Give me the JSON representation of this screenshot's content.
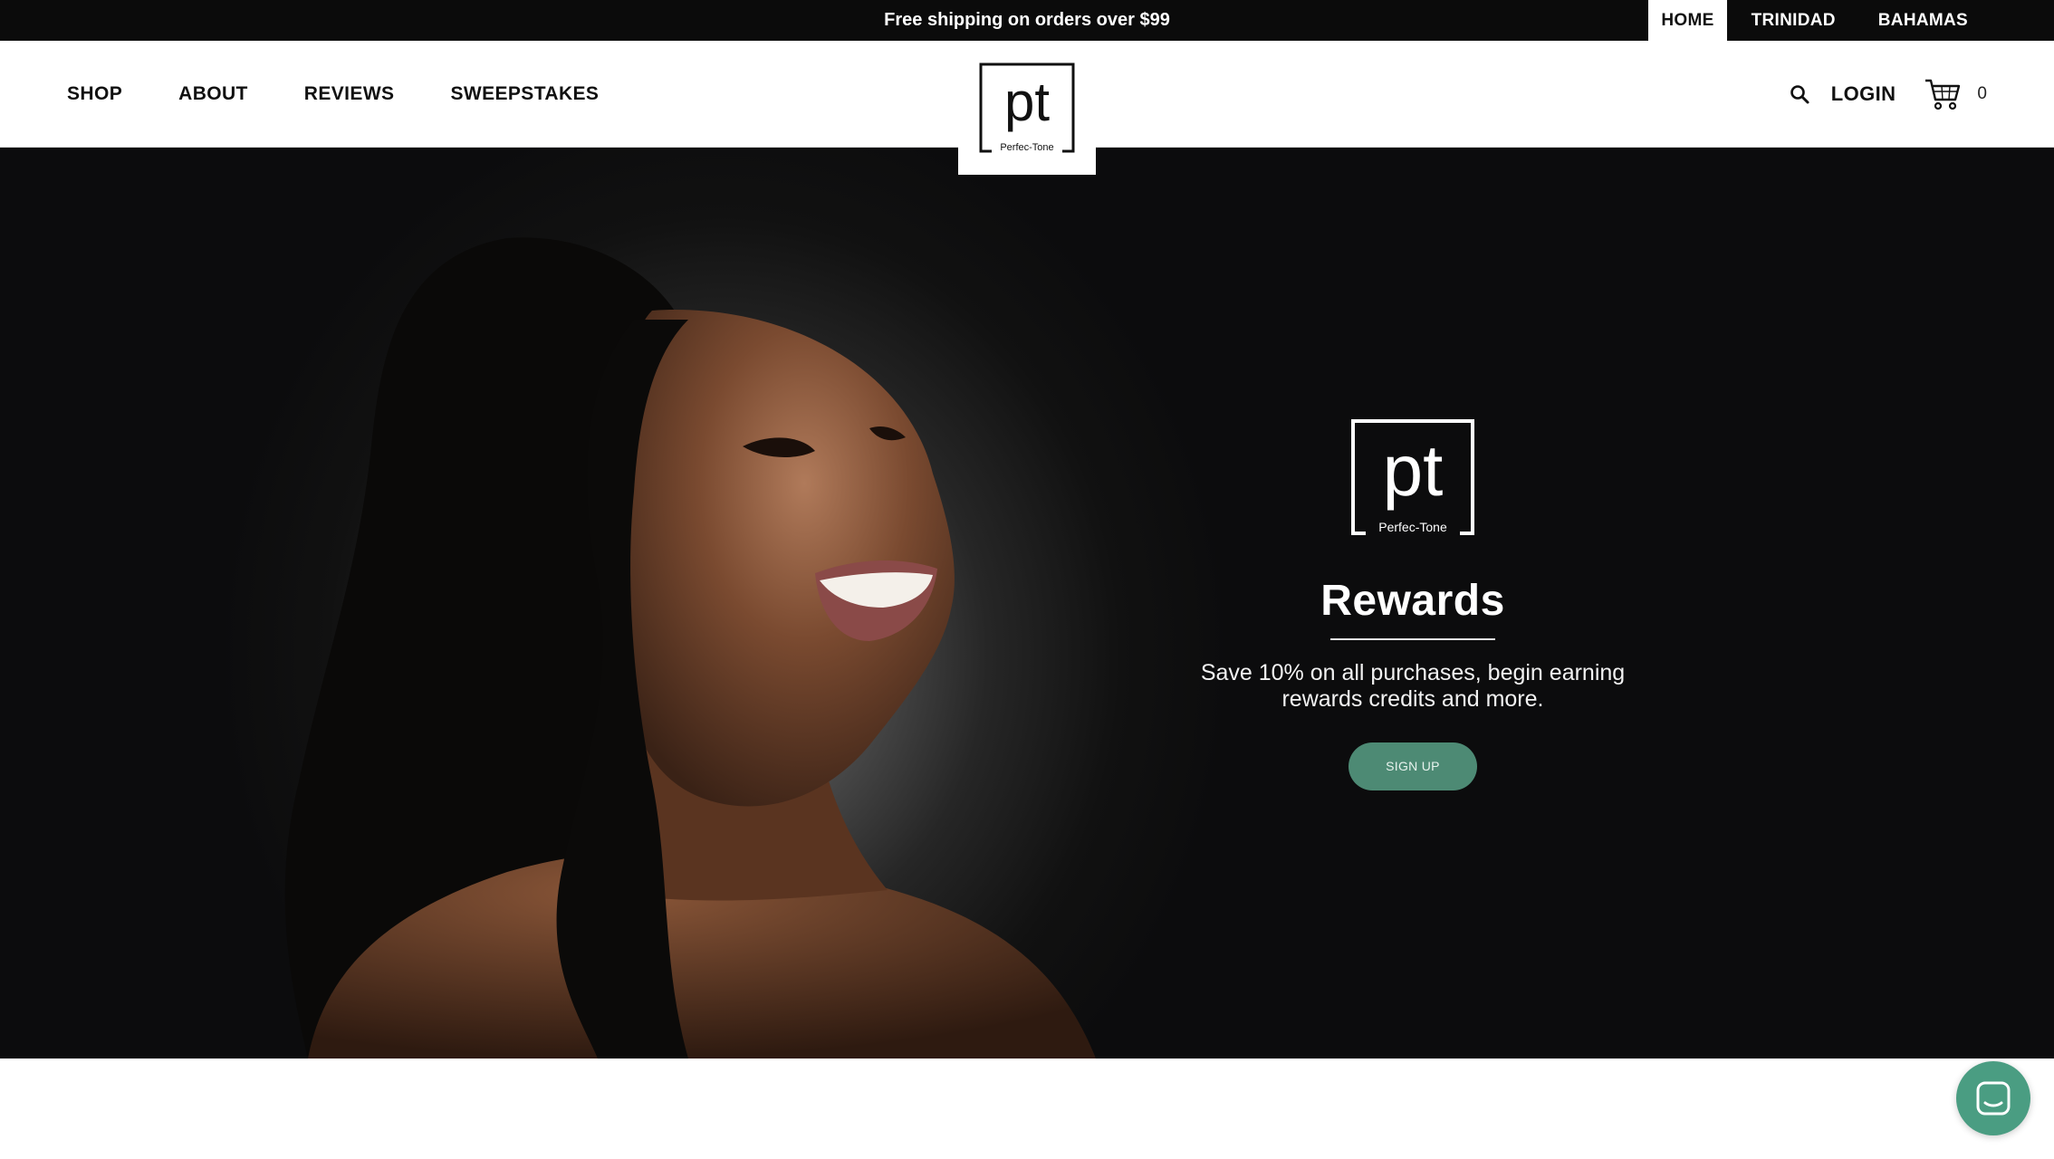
{
  "announcement": {
    "text": "Free shipping on orders over $99"
  },
  "regions": [
    {
      "label": "HOME",
      "active": true
    },
    {
      "label": "TRINIDAD",
      "active": false
    },
    {
      "label": "BAHAMAS",
      "active": false
    }
  ],
  "nav": {
    "items": [
      "SHOP",
      "ABOUT",
      "REVIEWS",
      "SWEEPSTAKES"
    ]
  },
  "brand": {
    "monogram": "pt",
    "name": "Perfec-Tone"
  },
  "header": {
    "login_label": "LOGIN",
    "cart_count": "0",
    "search_icon": "search-icon",
    "cart_icon": "cart-icon"
  },
  "hero": {
    "title": "Rewards",
    "text": "Save 10% on all purchases, begin earning rewards credits and more.",
    "cta_label": "SIGN UP",
    "cta_color": "#4d8a74",
    "background_color": "#0c0c0d"
  },
  "chat": {
    "icon": "chat-icon",
    "color": "#4a9d82"
  }
}
